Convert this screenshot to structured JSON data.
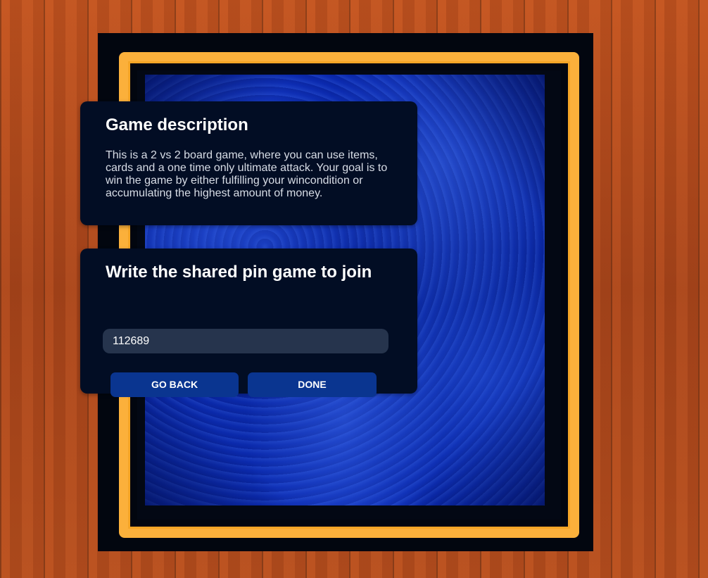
{
  "description_card": {
    "title": "Game description",
    "body": "This is a 2 vs 2 board game, where you can use items, cards and a one time only ultimate attack. Your goal is to win the game by either fulfilling your wincondition or accumulating the highest amount of money."
  },
  "join_card": {
    "title": "Write the shared pin game to join",
    "pin_value": "112689",
    "pin_placeholder": "",
    "back_label": "GO BACK",
    "done_label": "DONE"
  },
  "colors": {
    "frame_gold": "#fbb03b",
    "card_bg": "#020d24",
    "button_bg": "#0a3590",
    "input_bg": "#26344d",
    "water_blue": "#0b2ab0",
    "wood": "#b24a1c"
  }
}
